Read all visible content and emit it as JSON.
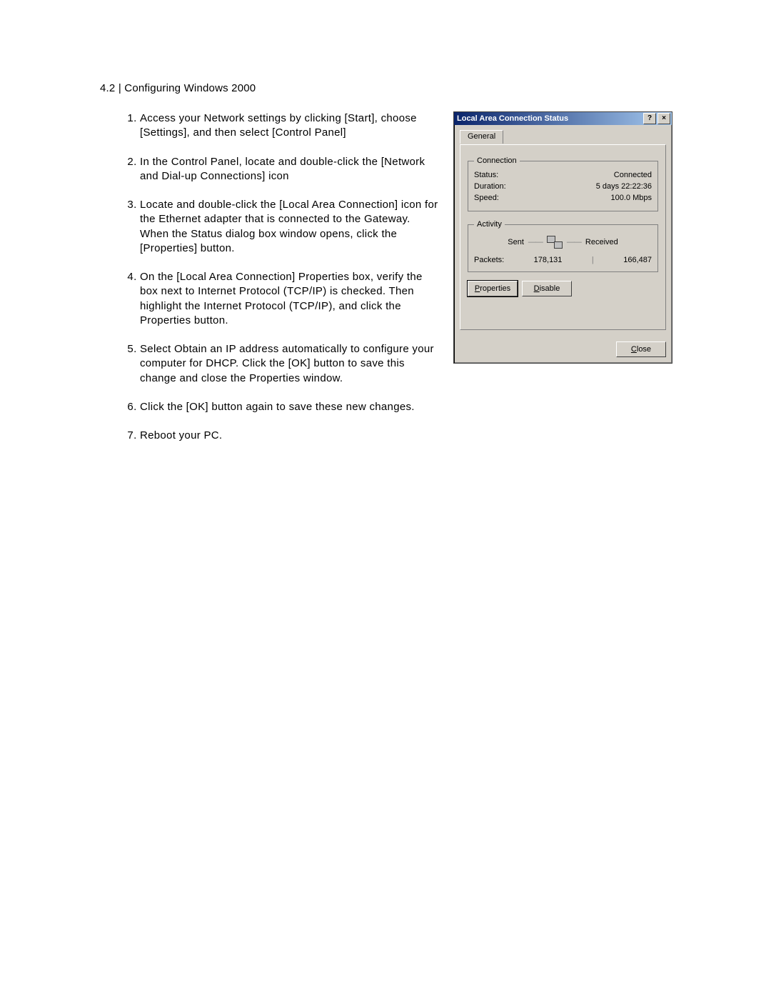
{
  "heading": "4.2 |  Configuring Windows 2000",
  "steps": {
    "s1": "Access your Network settings by clicking [Start], choose [Settings], and then select [Control Panel]",
    "s2": "In the Control Panel, locate and double-click the [Network and Dial-up Connections] icon",
    "s3": "Locate and double-click the [Local Area Connection] icon for the Ethernet adapter that is connected to the Gateway.  When the Status dialog box window opens, click the [Properties] button.",
    "s4": "On the [Local Area Connection] Properties box, verify the box next to Internet Protocol (TCP/IP) is checked. Then highlight the Internet Protocol (TCP/IP), and click the Properties button.",
    "s5": "Select Obtain an IP address automatically to configure your computer for DHCP. Click the [OK] button to save this change and close the Properties window.",
    "s6": "Click the [OK] button again to save these new changes.",
    "s7": "Reboot your PC."
  },
  "dialog": {
    "title": "Local Area Connection Status",
    "help_glyph": "?",
    "close_glyph": "×",
    "tab_general": "General",
    "grp_connection": "Connection",
    "lbl_status": "Status:",
    "val_status": "Connected",
    "lbl_duration": "Duration:",
    "val_duration": "5 days 22:22:36",
    "lbl_speed": "Speed:",
    "val_speed": "100.0 Mbps",
    "grp_activity": "Activity",
    "lbl_sent": "Sent",
    "lbl_received": "Received",
    "lbl_packets": "Packets:",
    "val_sent": "178,131",
    "val_received": "166,487",
    "btn_properties": "Properties",
    "btn_disable": "Disable",
    "btn_close": "Close"
  }
}
